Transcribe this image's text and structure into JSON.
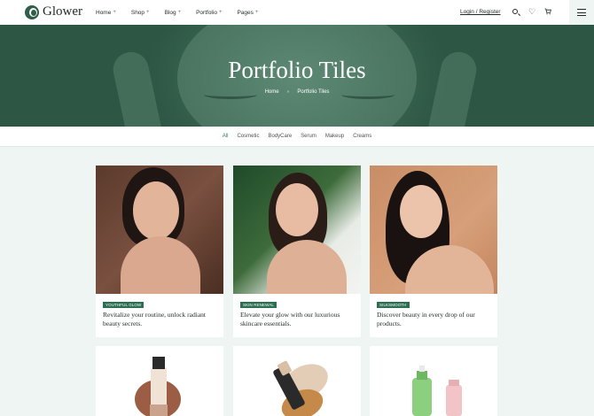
{
  "brand": {
    "name": "Glower"
  },
  "nav": {
    "items": [
      {
        "label": "Home",
        "plus": "+"
      },
      {
        "label": "Shop",
        "plus": "+"
      },
      {
        "label": "Blog",
        "plus": "+"
      },
      {
        "label": "Portfolio",
        "plus": "+"
      },
      {
        "label": "Pages",
        "plus": "+"
      }
    ],
    "login": "Login / Register"
  },
  "hero": {
    "title": "Portfolio Tiles",
    "breadcrumb": {
      "home": "Home",
      "sep": "»",
      "current": "Portfolio Tiles"
    }
  },
  "filters": [
    "All",
    "Cosmetic",
    "BodyCare",
    "Serum",
    "Makeup",
    "Creams"
  ],
  "cards": [
    {
      "tag": "YOUTHFUL GLOW",
      "text": "Revitalize your routine, unlock radiant beauty secrets."
    },
    {
      "tag": "SKIN RENEWAL",
      "text": "Elevate your glow with our luxurious skincare essentials."
    },
    {
      "tag": "SILKSMOOTH",
      "text": "Discover beauty in every drop of our products."
    }
  ],
  "colors": {
    "accent": "#2c6e52",
    "hero": "#3a6651",
    "background": "#eef5f2"
  },
  "icons": [
    "search-icon",
    "heart-icon",
    "cart-icon",
    "menu-icon"
  ]
}
